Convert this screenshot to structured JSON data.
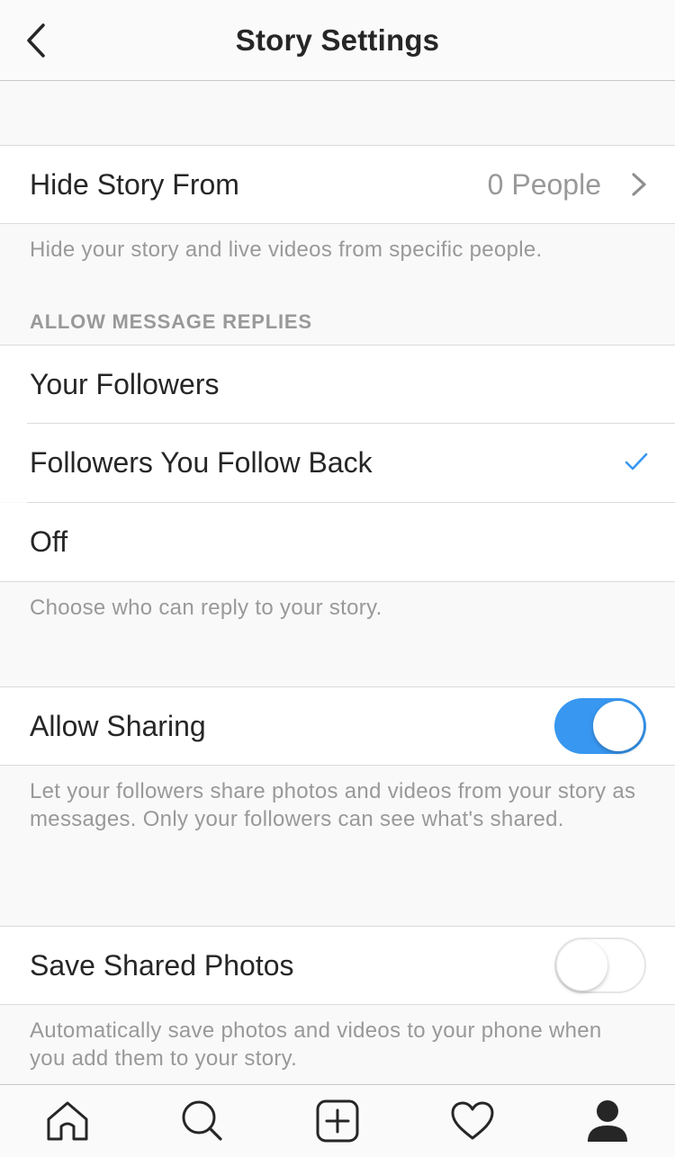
{
  "header": {
    "title": "Story Settings",
    "back_icon": "chevron-left-icon"
  },
  "hide_story": {
    "label": "Hide Story From",
    "value": "0 People",
    "description": "Hide your story and live videos from specific people."
  },
  "message_replies": {
    "section_title": "ALLOW MESSAGE REPLIES",
    "options": [
      {
        "label": "Your Followers",
        "selected": false
      },
      {
        "label": "Followers You Follow Back",
        "selected": true
      },
      {
        "label": "Off",
        "selected": false
      }
    ],
    "description": "Choose who can reply to your story."
  },
  "allow_sharing": {
    "label": "Allow Sharing",
    "enabled": true,
    "description": "Let your followers share photos and videos from your story as messages. Only your followers can see what's shared."
  },
  "save_shared_photos": {
    "label": "Save Shared Photos",
    "enabled": false,
    "description": "Automatically save photos and videos to your phone when you add them to your story."
  },
  "tabbar": {
    "icons": [
      "home-icon",
      "search-icon",
      "new-post-icon",
      "activity-heart-icon",
      "profile-icon"
    ],
    "active": "profile-icon"
  },
  "colors": {
    "accent": "#3897f0",
    "secondary_text": "#999999",
    "divider": "#dbdbdb"
  }
}
